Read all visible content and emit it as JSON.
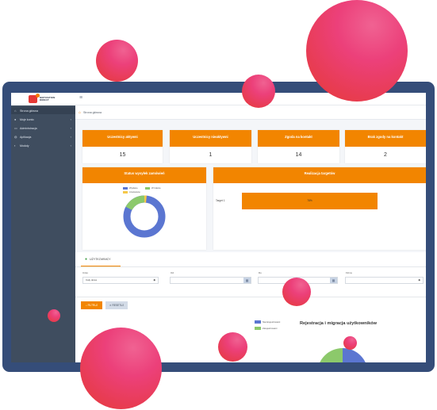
{
  "brand": {
    "logo_line1": "MOTIVATION",
    "logo_line2": "DIRECT"
  },
  "sidebar": {
    "items": [
      {
        "label": "Strona główna",
        "icon": "home-icon",
        "active": true
      },
      {
        "label": "Moje konto",
        "icon": "user-icon",
        "active": false
      },
      {
        "label": "Administracja",
        "icon": "monitor-icon",
        "active": false
      },
      {
        "label": "Aplikacja",
        "icon": "globe-icon",
        "active": false
      },
      {
        "label": "Moduły",
        "icon": "modules-icon",
        "active": false
      }
    ]
  },
  "breadcrumb": {
    "label": "Strona główna"
  },
  "stats": [
    {
      "title": "Uczestnicy aktywni",
      "value": "15"
    },
    {
      "title": "Uczestnicy nieaktywni",
      "value": "1"
    },
    {
      "title": "Zgoda na kontakt",
      "value": "14"
    },
    {
      "title": "Brak zgody na kontakt",
      "value": "2"
    }
  ],
  "orders_status": {
    "title": "Status wysyłek zamówień",
    "legend": [
      "Wysłane",
      "W trakcie",
      "Anulowane"
    ],
    "colors": [
      "#5b76d1",
      "#8cc96b",
      "#f7c948"
    ]
  },
  "targets": {
    "title": "Realizacja targetów",
    "row_label": "Target 1",
    "bar_text": "78%"
  },
  "users": {
    "tab_label": "UŻYTKOWNICY",
    "filters": {
      "czas_label": "Czas",
      "czas_value": "Cały okres",
      "od_label": "Od",
      "do_label": "Do",
      "firma_label": "Firma"
    },
    "search_button": "FILTRUJ",
    "reset_button": "RESETUJ",
    "chart_title": "Rejestracja i migracja użytkowników",
    "chart_legend": [
      "Niezarejestrowani",
      "Zarejestrowani"
    ],
    "chart_colors": [
      "#5b76d1",
      "#8cc96b"
    ]
  },
  "colors": {
    "accent": "#f28500",
    "sidebar": "#3f4d5f",
    "frame": "#354d79",
    "bubble": "#e53935"
  }
}
